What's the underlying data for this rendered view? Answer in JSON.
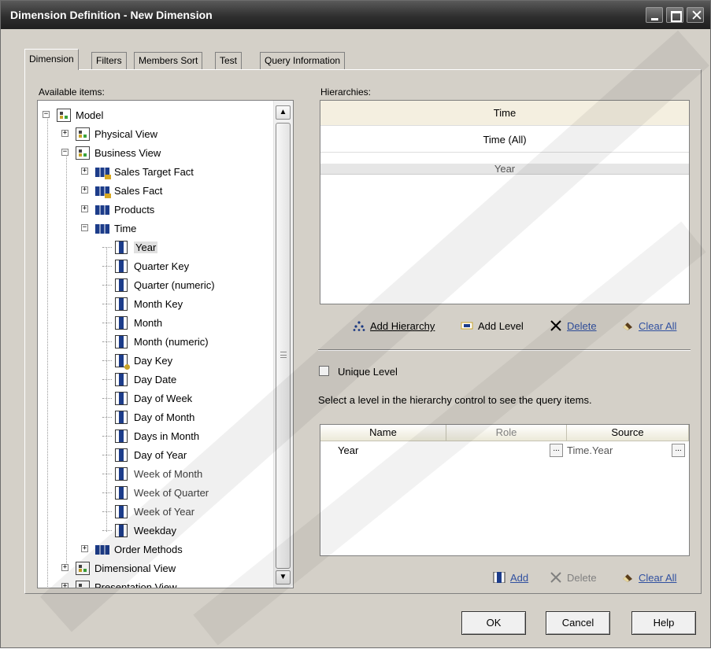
{
  "window": {
    "title": "Dimension Definition - New Dimension"
  },
  "tabs": [
    "Dimension",
    "Filters",
    "Members Sort",
    "Test",
    "Query Information"
  ],
  "available": {
    "label": "Available items:",
    "tree": [
      {
        "label": "Model",
        "icon": "model-icon",
        "expander": "−"
      },
      {
        "label": "Physical View",
        "icon": "model-icon",
        "expander": "+"
      },
      {
        "label": "Business View",
        "icon": "model-icon",
        "expander": "−"
      },
      {
        "label": "Sales Target Fact",
        "icon": "fact-icon",
        "expander": "+"
      },
      {
        "label": "Sales Fact",
        "icon": "fact-icon",
        "expander": "+"
      },
      {
        "label": "Products",
        "icon": "dimension-icon",
        "expander": "+"
      },
      {
        "label": "Time",
        "icon": "dimension-icon",
        "expander": "−"
      },
      {
        "label": "Year",
        "icon": "column-icon"
      },
      {
        "label": "Quarter Key",
        "icon": "column-icon"
      },
      {
        "label": "Quarter (numeric)",
        "icon": "column-icon"
      },
      {
        "label": "Month Key",
        "icon": "column-icon"
      },
      {
        "label": "Month",
        "icon": "column-icon"
      },
      {
        "label": "Month (numeric)",
        "icon": "column-icon"
      },
      {
        "label": "Day Key",
        "icon": "key-column-icon"
      },
      {
        "label": "Day Date",
        "icon": "column-icon"
      },
      {
        "label": "Day of Week",
        "icon": "column-icon"
      },
      {
        "label": "Day of Month",
        "icon": "column-icon"
      },
      {
        "label": "Days in Month",
        "icon": "column-icon"
      },
      {
        "label": "Day of Year",
        "icon": "column-icon"
      },
      {
        "label": "Week of Month",
        "icon": "column-icon"
      },
      {
        "label": "Week of Quarter",
        "icon": "column-icon"
      },
      {
        "label": "Week of Year",
        "icon": "column-icon"
      },
      {
        "label": "Weekday",
        "icon": "column-icon"
      },
      {
        "label": "Order Methods",
        "icon": "dimension-icon",
        "expander": "+"
      },
      {
        "label": "Dimensional View",
        "icon": "model-icon",
        "expander": "+"
      },
      {
        "label": "Presentation View",
        "icon": "model-icon",
        "expander": "+"
      }
    ]
  },
  "hierarchies": {
    "label": "Hierarchies:",
    "rows": [
      "Time",
      "Time (All)",
      "Year"
    ],
    "actions": {
      "add_hierarchy": "Add Hierarchy",
      "add_level": "Add Level",
      "delete": "Delete",
      "clear_all": "Clear All"
    }
  },
  "level": {
    "unique_label": "Unique Level",
    "unique_checked": false,
    "hint": "Select a level in the hierarchy control to see the query items.",
    "columns": [
      "Name",
      "Role",
      "Source"
    ],
    "rows": [
      {
        "name": "Year",
        "role": "",
        "source": "Time.Year"
      }
    ],
    "ellipsis": "...",
    "actions": {
      "add": "Add",
      "delete": "Delete",
      "clear_all": "Clear All"
    }
  },
  "buttons": {
    "ok": "OK",
    "cancel": "Cancel",
    "help": "Help"
  },
  "colors": {
    "title_bar": "#2f2f2f",
    "dialog_bg": "#d4d0c8",
    "hierarchy_header": "#f4efe0",
    "selected_row": "#e6e6e6",
    "icon_blue": "#1c3c8a"
  }
}
